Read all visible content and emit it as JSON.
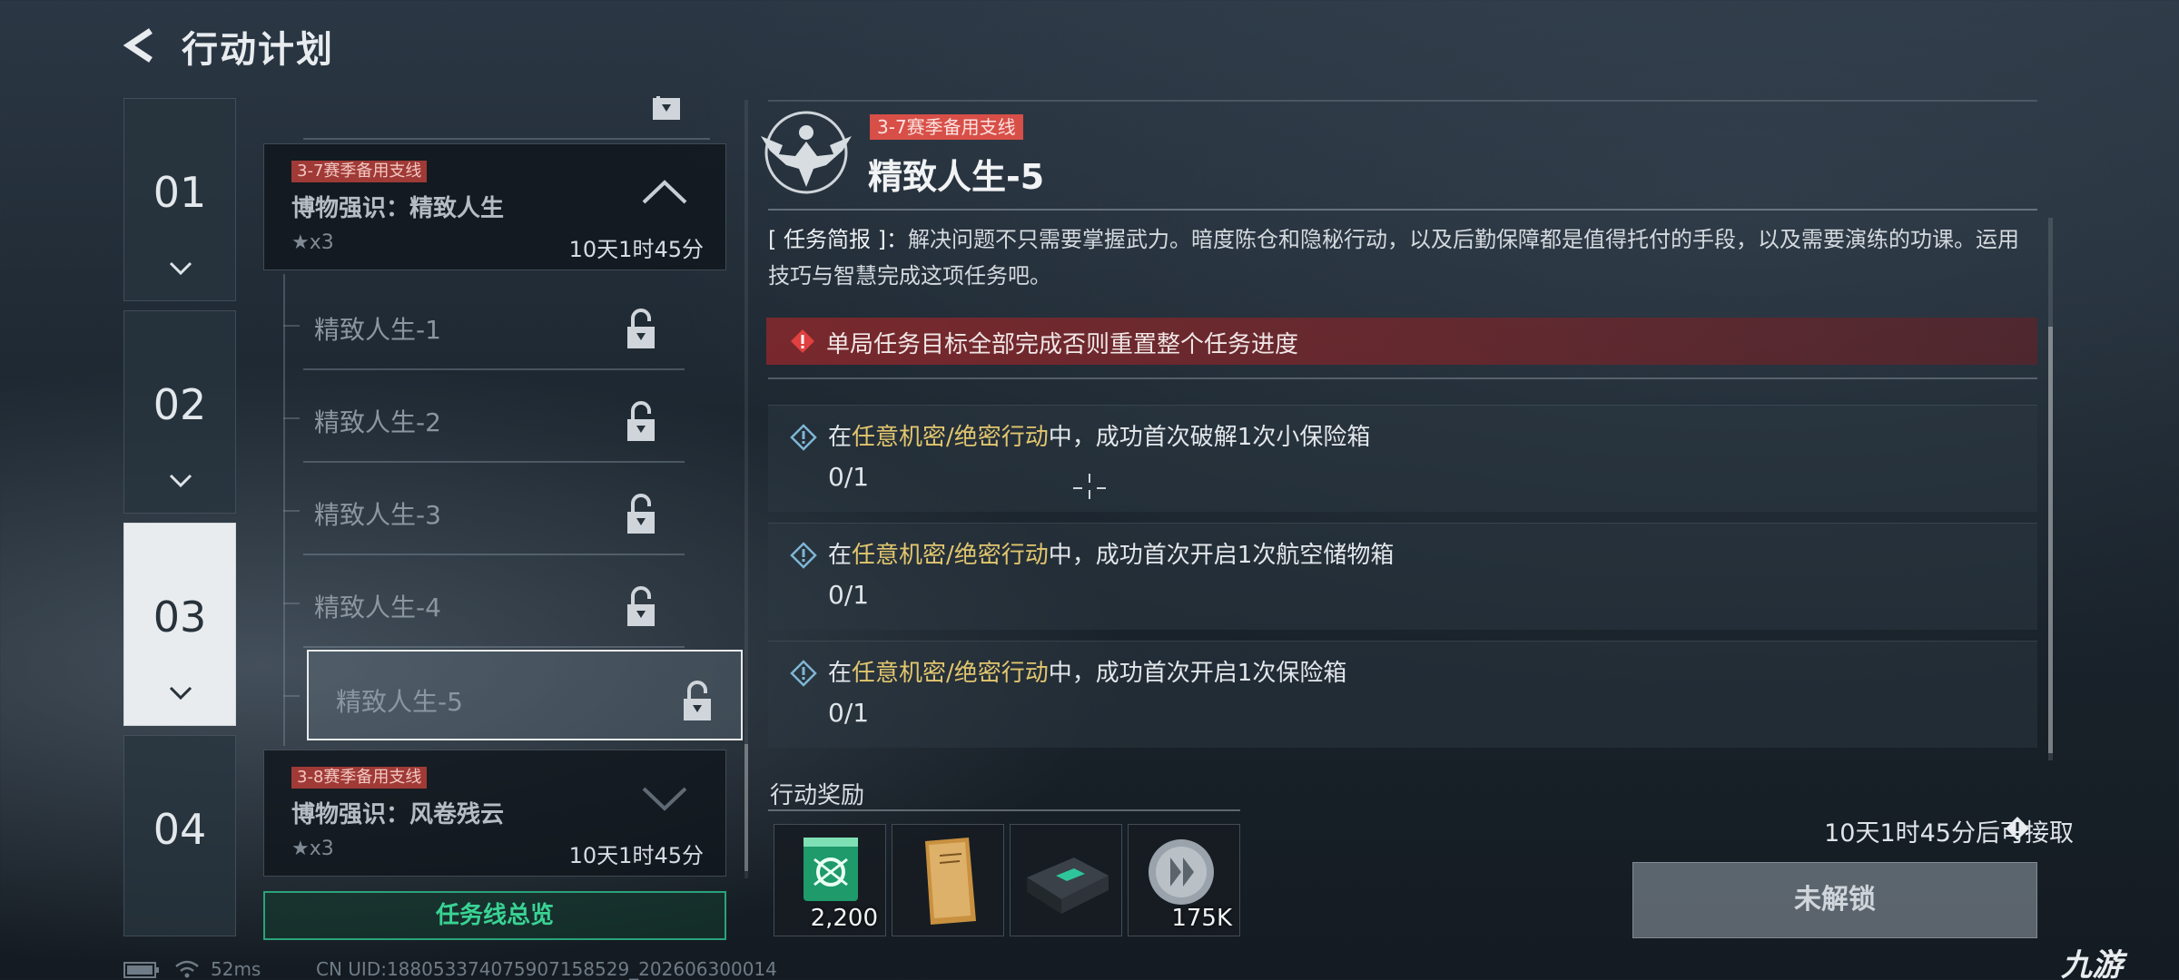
{
  "header": {
    "title": "行动计划"
  },
  "chapters": [
    {
      "num": "01",
      "active": false
    },
    {
      "num": "02",
      "active": false
    },
    {
      "num": "03",
      "active": true
    },
    {
      "num": "04",
      "active": false
    }
  ],
  "mission_list": {
    "group_expanded": {
      "tag": "3-7赛季备用支线",
      "name": "博物强识：精致人生",
      "stars": "★x3",
      "time": "10天1时45分"
    },
    "sub_missions": [
      {
        "name": "精致人生-1",
        "icon": "lock-icon"
      },
      {
        "name": "精致人生-2",
        "icon": "lock-icon"
      },
      {
        "name": "精致人生-3",
        "icon": "lock-icon"
      },
      {
        "name": "精致人生-4",
        "icon": "lock-icon"
      },
      {
        "name": "精致人生-5",
        "icon": "lock-icon",
        "selected": true
      }
    ],
    "group_collapsed": {
      "tag": "3-8赛季备用支线",
      "name": "博物强识：风卷残云",
      "stars": "★x3",
      "time": "10天1时45分"
    },
    "overview_button": "任务线总览"
  },
  "detail": {
    "tag": "3-7赛季备用支线",
    "title": "精致人生-5",
    "brief_label": "[ 任务简报 ]：",
    "brief_text": "解决问题不只需要掌握武力。暗度陈仓和隐秘行动，以及后勤保障都是值得托付的手段，以及需要演练的功课。运用技巧与智慧完成这项任务吧。",
    "warning": "单局任务目标全部完成否则重置整个任务进度",
    "objectives": [
      {
        "pre": "在",
        "highlight": "任意机密/绝密行动",
        "post": "中，成功首次破解1次小保险箱",
        "progress": "0/1"
      },
      {
        "pre": "在",
        "highlight": "任意机密/绝密行动",
        "post": "中，成功首次开启1次航空储物箱",
        "progress": "0/1"
      },
      {
        "pre": "在",
        "highlight": "任意机密/绝密行动",
        "post": "中，成功首次开启1次保险箱",
        "progress": "0/1"
      }
    ]
  },
  "rewards": {
    "title": "行动奖励",
    "items": [
      {
        "icon": "green-drone-card-icon",
        "qty": "2,200"
      },
      {
        "icon": "document-folder-icon",
        "qty": ""
      },
      {
        "icon": "storage-case-icon",
        "qty": ""
      },
      {
        "icon": "silver-coin-icon",
        "qty": "175K"
      }
    ],
    "available_text": "10天1时45分后可接取",
    "unlock_button": "未解锁"
  },
  "status_bar": {
    "ping": "52ms",
    "uid": "CN UID:1880533740759071585​29_202606300014"
  },
  "brand": "九游",
  "colors": {
    "accent_green": "#39d394",
    "tag_red": "#d84f48",
    "highlight_gold": "#e2c66e",
    "warning_red": "#a0282a"
  }
}
